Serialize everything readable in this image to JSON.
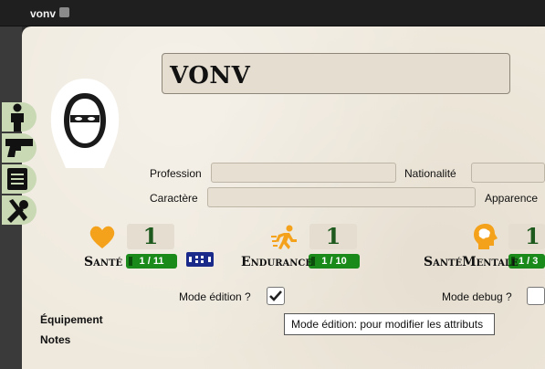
{
  "window": {
    "title": "vonv"
  },
  "character": {
    "name": "VONV"
  },
  "fields": {
    "profession_label": "Profession",
    "nationalite_label": "Nationalité",
    "caractere_label": "Caractère",
    "apparence_label": "Apparence"
  },
  "sidebar": {
    "items": [
      "character-icon",
      "weapon-icon",
      "notes-icon",
      "tools-icon"
    ]
  },
  "stats": [
    {
      "name": "Santé",
      "value": "1",
      "max": "1 / 11",
      "color": "#f4a21c"
    },
    {
      "name": "Endurance",
      "value": "1",
      "max": "1 / 10",
      "color": "#f4a21c"
    },
    {
      "name": "SantéMentale",
      "value": "1",
      "max": "1 / 3",
      "color": "#f4a21c"
    }
  ],
  "toggles": {
    "edit_mode_label": "Mode édition ?",
    "edit_mode_checked": true,
    "debug_mode_label": "Mode debug ?",
    "debug_mode_checked": false
  },
  "sections": {
    "equipment": "Équipement",
    "notes": "Notes"
  },
  "tooltip": {
    "text": "Mode édition: pour modifier les attributs"
  },
  "colors": {
    "accent_green": "#1a8a1a",
    "sidebar_bg": "#c8d9b4",
    "dice_blue": "#1a2a8a"
  }
}
